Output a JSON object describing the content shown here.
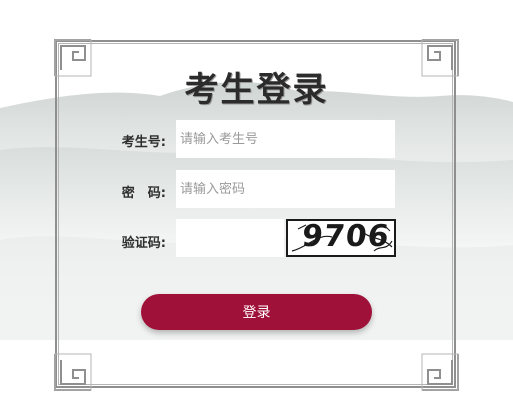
{
  "login": {
    "title": "考生登录",
    "student_id_label": "考生号:",
    "student_id_placeholder": "请输入考生号",
    "student_id_value": "",
    "password_label": "密　码:",
    "password_placeholder": "请输入密码",
    "password_value": "",
    "captcha_label": "验证码:",
    "captcha_value": "",
    "captcha_image_text": "9706",
    "submit_label": "登录"
  },
  "colors": {
    "accent": "#a0113a",
    "frame": "#8f8f8f",
    "title": "#2b2b2b"
  },
  "icons": {
    "corners": "fret-corner-ornament",
    "background": "ink-wash-mountains"
  }
}
